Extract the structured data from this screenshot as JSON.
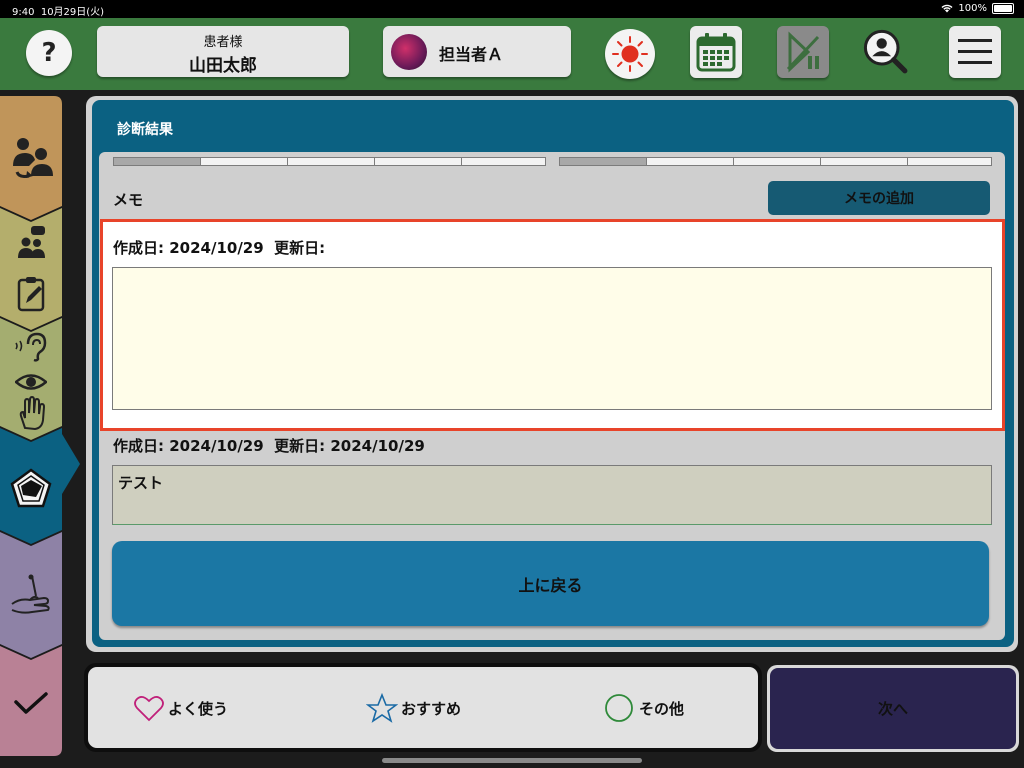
{
  "status": {
    "time": "9:40",
    "date": "10月29日(火)",
    "battery": "100%"
  },
  "header": {
    "help_label": "?",
    "patient_caption": "患者様",
    "patient_name": "山田太郎",
    "staff_name": "担当者Ａ",
    "icons": [
      "record-icon",
      "calendar-icon",
      "skip-icon",
      "search-user-icon",
      "menu-icon"
    ]
  },
  "sidebar": {
    "tabs": [
      {
        "icon": "relay-icon",
        "color": "#c0955a"
      },
      {
        "icon": "chat-clipboard-icon",
        "color": "#b4ae6c"
      },
      {
        "icon": "senses-icon",
        "color": "#a4ad70"
      },
      {
        "icon": "pentagon-chart-icon",
        "color": "#0b6182"
      },
      {
        "icon": "needle-hand-icon",
        "color": "#8e82a6"
      },
      {
        "icon": "check-icon",
        "color": "#b98195"
      }
    ]
  },
  "main": {
    "title": "診断結果",
    "memo_label": "メモ",
    "add_memo_label": "メモの追加",
    "memos": [
      {
        "created_label": "作成日: 2024/10/29",
        "updated_label": "更新日:",
        "content": ""
      },
      {
        "created_label": "作成日: 2024/10/29",
        "updated_label": "更新日: 2024/10/29",
        "content": "テスト"
      }
    ],
    "back_label": "上に戻る"
  },
  "footer": {
    "favorites_label": "よく使う",
    "recommended_label": "おすすめ",
    "other_label": "その他",
    "next_label": "次へ"
  },
  "colors": {
    "header_green": "#3a7a3e",
    "teal": "#0b6182",
    "button_blue": "#1b77a4",
    "highlight_red": "#e8442a",
    "next_navy": "#2a244f",
    "memo_bg": "#fffde9",
    "memo_saved_bg": "#cfcfbf"
  }
}
